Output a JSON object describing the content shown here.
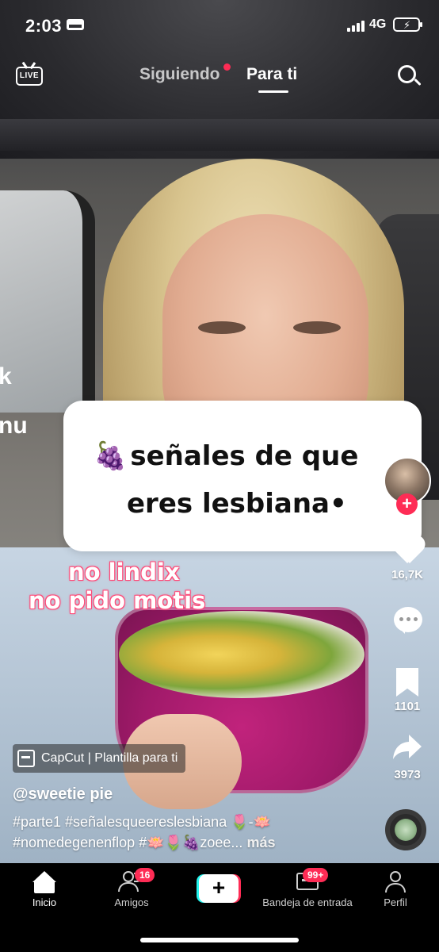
{
  "status_bar": {
    "time": "2:03",
    "network": "4G",
    "battery_level": 0.9,
    "icons": [
      "bed-icon",
      "signal-icon",
      "battery-charging-icon"
    ]
  },
  "top_nav": {
    "live_label": "LIVE",
    "tabs": [
      {
        "label": "Siguiendo",
        "active": false,
        "has_dot": true
      },
      {
        "label": "Para ti",
        "active": true
      }
    ],
    "icons": [
      "live-tv-icon",
      "search-icon"
    ]
  },
  "video": {
    "edge_text": [
      "k",
      "nu"
    ],
    "card_lines": [
      "señales de que",
      "eres lesbiana"
    ],
    "card_line2_suffix": "•",
    "card_emoji": "🍇",
    "overlay_lines": [
      "no lindix",
      "no pido motis"
    ]
  },
  "right_rail": {
    "likes": "16,7K",
    "bookmarks": "1101",
    "shares": "3973",
    "follow_plus": "+",
    "icons": [
      "avatar",
      "heart-icon",
      "comment-icon",
      "bookmark-icon",
      "share-icon",
      "music-disc-icon"
    ]
  },
  "meta": {
    "template_label": "CapCut | Plantilla para ti",
    "username": "@sweetie pie",
    "caption_line1": "#parte1 #señalesqueereslesbiana 🌷-🪷",
    "caption_line2": "#nomedegenenflop #🪷🌷🍇zoee...",
    "more_label": "más"
  },
  "tab_bar": {
    "items": [
      {
        "label": "Inicio",
        "active": true
      },
      {
        "label": "Amigos",
        "badge": "16"
      },
      {
        "label": "",
        "create": true
      },
      {
        "label": "Bandeja de entrada",
        "badge": "99+"
      },
      {
        "label": "Perfil"
      }
    ],
    "create_symbol": "+"
  },
  "colors": {
    "accent_red": "#fe2c55",
    "accent_cyan": "#25f4ee",
    "battery_green": "#43d35b",
    "overlay_pink": "#ff4a78"
  }
}
